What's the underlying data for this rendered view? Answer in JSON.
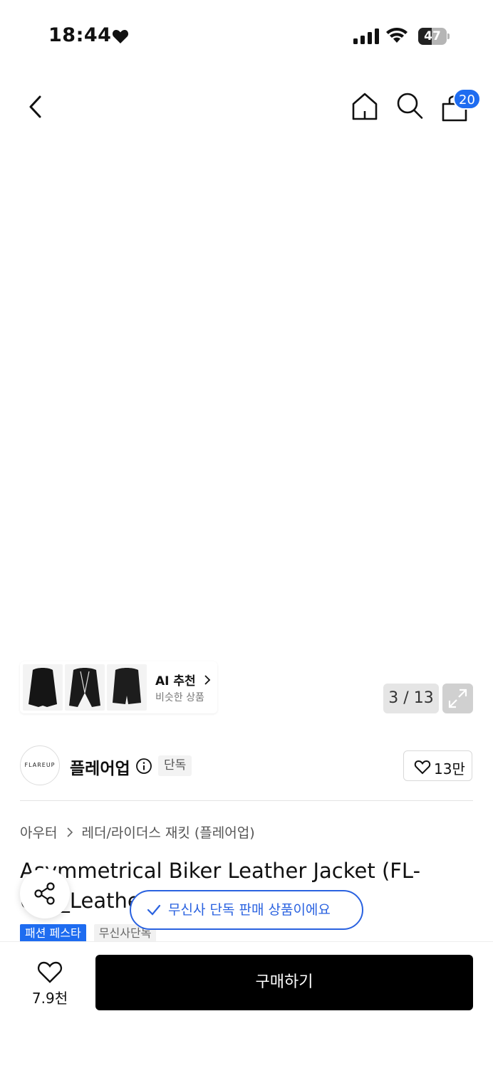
{
  "status_bar": {
    "time": "18:44",
    "battery": "47",
    "battery_level": 0.47
  },
  "header": {
    "cart_count": "20"
  },
  "gallery": {
    "counter": "3 / 13"
  },
  "ai_recommend": {
    "title": "AI 추천",
    "subtitle": "비슷한 상품"
  },
  "brand": {
    "name": "플레어업",
    "logo_text": "FLAREUP",
    "exclusive_tag": "단독",
    "likes": "13만"
  },
  "breadcrumb": {
    "category": "아우터",
    "subcategory": "레더/라이더스 재킷 (플레어업)"
  },
  "product": {
    "title": "Asymmetrical Biker Leather Jacket (FL-047_Leather)",
    "tags": [
      "패션 페스타",
      "무신사단독"
    ]
  },
  "toast": {
    "message": "무신사 단독 판매 상품이에요"
  },
  "bottom_bar": {
    "wish_count": "7.9천",
    "buy_label": "구매하기"
  },
  "colors": {
    "accent": "#1e6cf0",
    "toast": "#2a62e0",
    "buy_button": "#000000"
  },
  "icons": [
    "heart-icon",
    "signal-icon",
    "wifi-icon",
    "battery-icon",
    "back-arrow-icon",
    "home-icon",
    "search-icon",
    "shopping-bag-icon",
    "chevron-right-icon",
    "expand-icon",
    "info-icon",
    "share-icon",
    "check-icon"
  ]
}
